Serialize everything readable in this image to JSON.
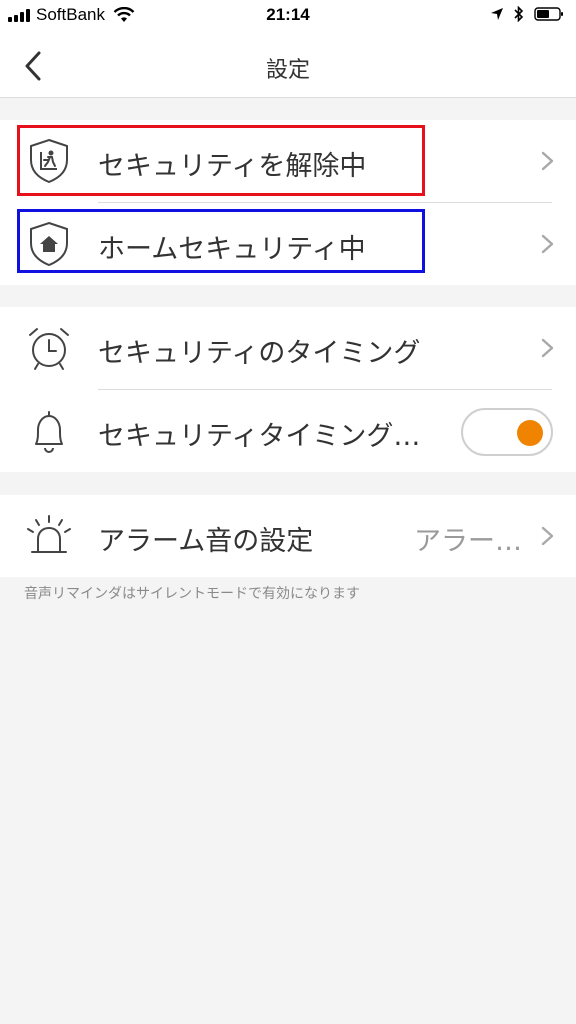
{
  "status_bar": {
    "carrier": "SoftBank",
    "time": "21:14"
  },
  "nav": {
    "title": "設定"
  },
  "security_modes": [
    {
      "label": "セキュリティを解除中",
      "icon": "shield-person-icon"
    },
    {
      "label": "ホームセキュリティ中",
      "icon": "shield-home-icon"
    }
  ],
  "timing": {
    "timing_label": "セキュリティのタイミング",
    "timing_reminder_label": "セキュリティタイミング…",
    "toggle_on": true,
    "toggle_color": "#f08300"
  },
  "alarm": {
    "label": "アラーム音の設定",
    "value": "アラー…"
  },
  "footnote": "音声リマインダはサイレントモードで有効になります",
  "colors": {
    "accent": "#f08300",
    "highlight_red": "#e8101a",
    "highlight_blue": "#1010e0"
  }
}
